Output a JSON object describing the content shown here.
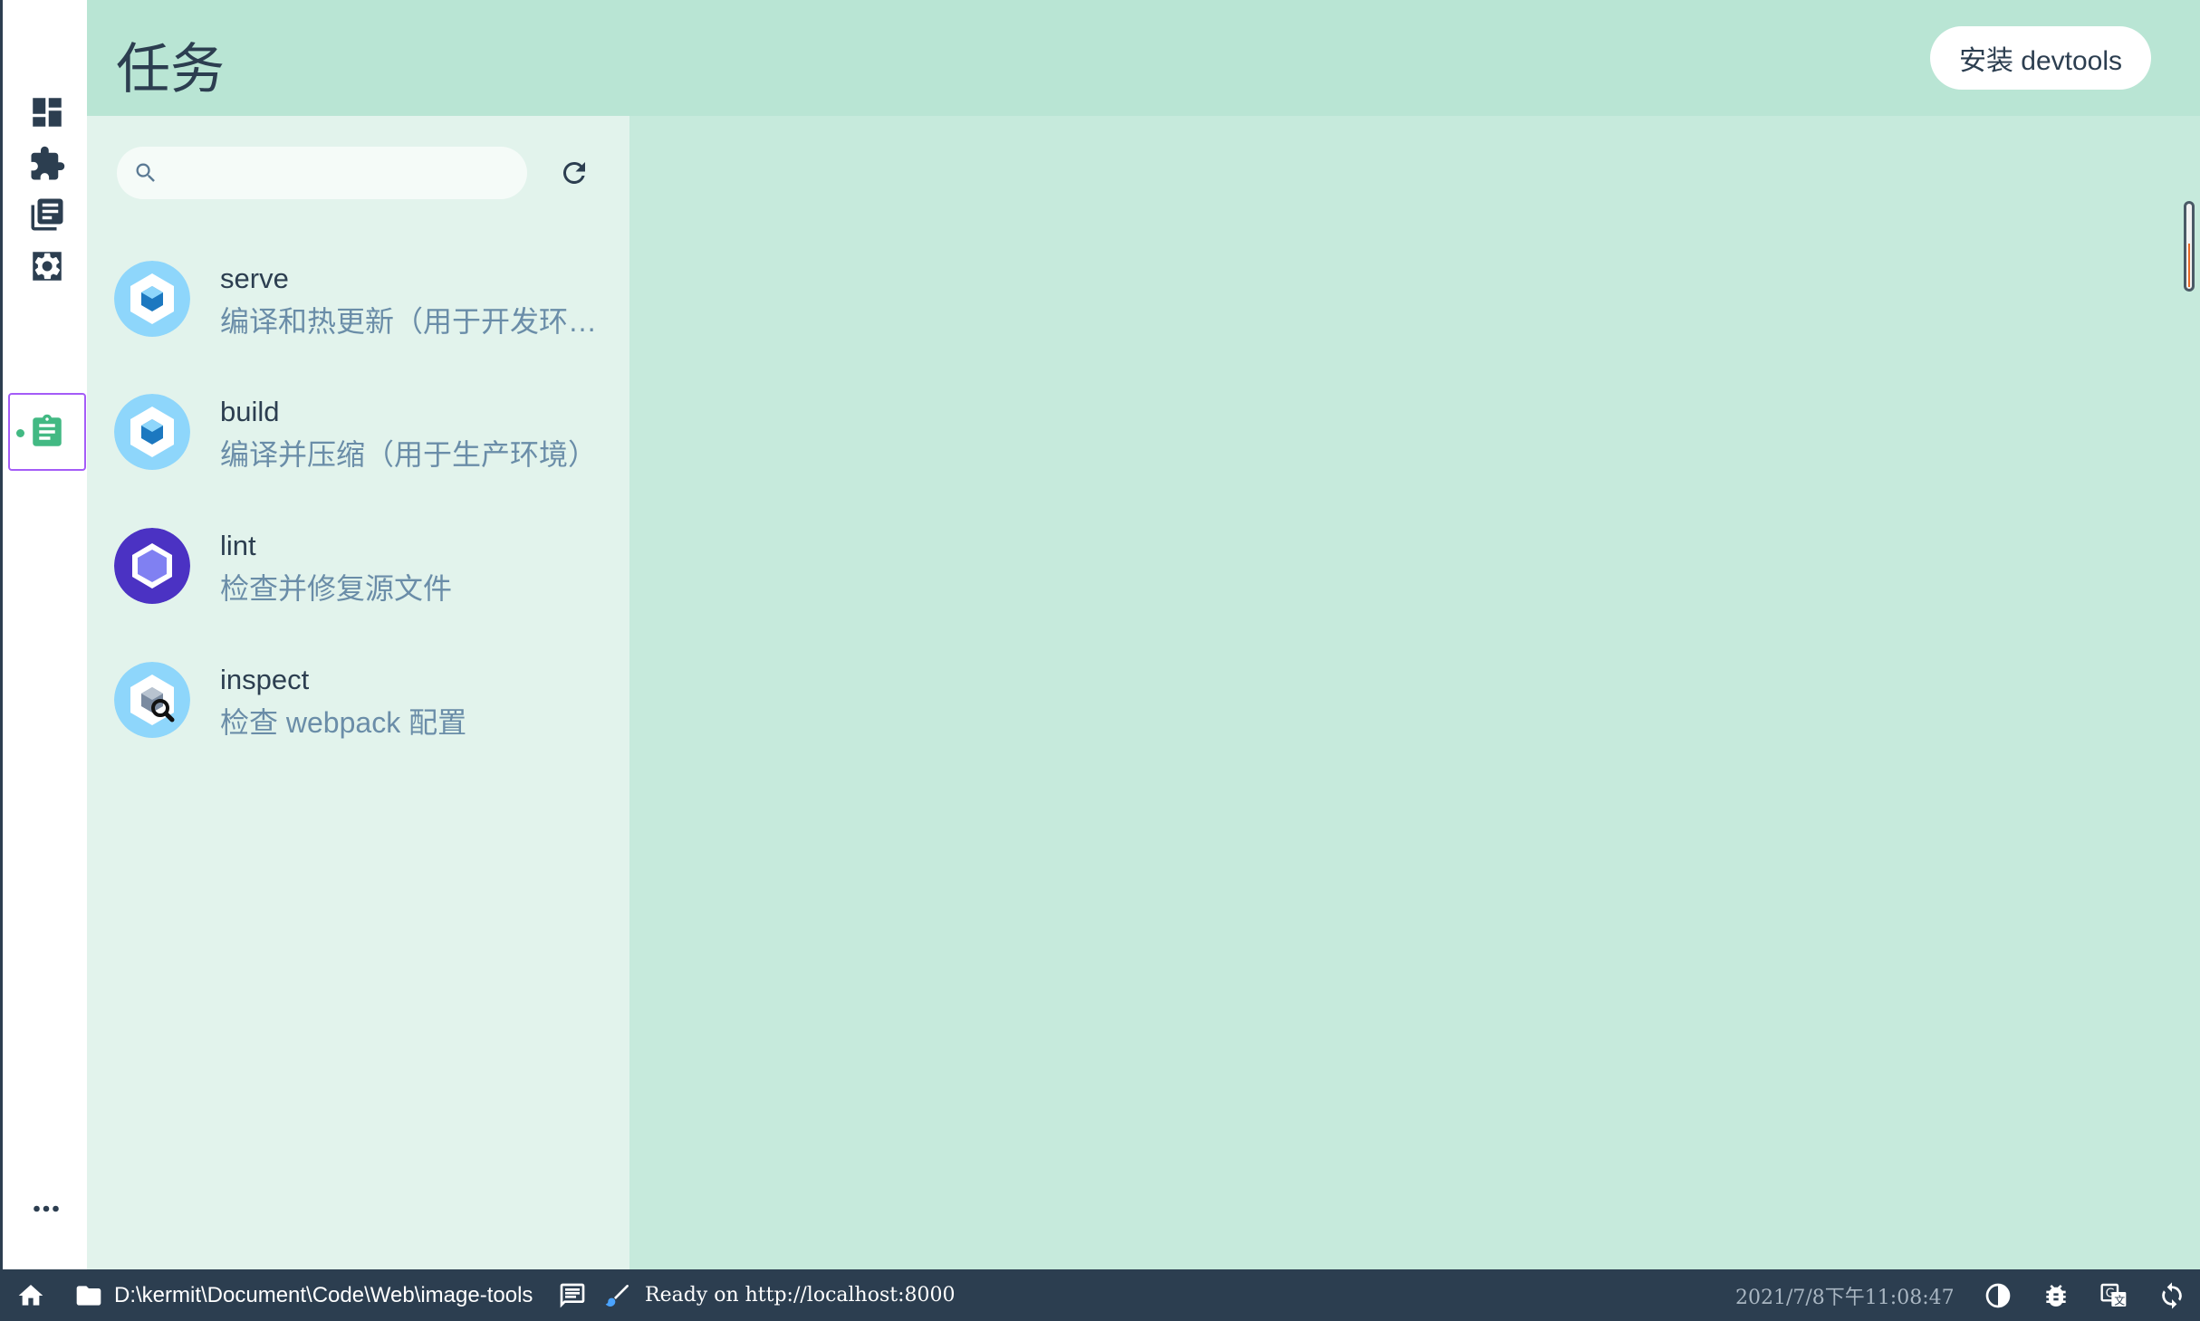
{
  "page": {
    "title": "任务"
  },
  "header": {
    "install_devtools_label": "安装 devtools"
  },
  "rail": {
    "items": [
      {
        "name": "dashboard",
        "icon": "dashboard-icon",
        "active": false
      },
      {
        "name": "plugins",
        "icon": "puzzle-icon",
        "active": false
      },
      {
        "name": "dependencies",
        "icon": "library-books-icon",
        "active": false
      },
      {
        "name": "configuration",
        "icon": "settings-icon",
        "active": false
      },
      {
        "name": "tasks",
        "icon": "assignment-icon",
        "active": true
      }
    ],
    "more_icon": "more-horizontal-icon"
  },
  "search": {
    "placeholder": "",
    "value": ""
  },
  "tasks": [
    {
      "name": "serve",
      "description": "编译和热更新（用于开发环境）",
      "icon": "webpack-icon"
    },
    {
      "name": "build",
      "description": "编译并压缩（用于生产环境）",
      "icon": "webpack-icon"
    },
    {
      "name": "lint",
      "description": "检查并修复源文件",
      "icon": "eslint-icon"
    },
    {
      "name": "inspect",
      "description": "检查 webpack 配置",
      "icon": "webpack-inspect-icon"
    }
  ],
  "statusbar": {
    "cwd": "D:\\kermit\\Document\\Code\\Web\\image-tools",
    "log": "Ready on http://localhost:8000",
    "time": "2021/7/8下午11:08:47"
  },
  "colors": {
    "accent": "#42b983",
    "active_border": "#a45cf7",
    "header_bg": "#b9e5d4",
    "panel_bg": "#e2f3ec",
    "content_bg": "#c6eadc",
    "statusbar_bg": "#2c3e50",
    "secondary_text": "#6a8da8"
  }
}
